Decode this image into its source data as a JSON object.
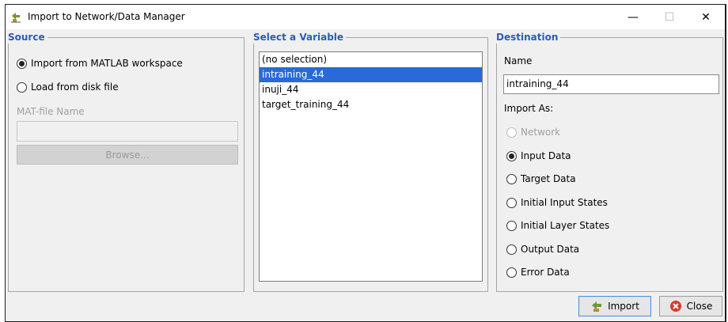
{
  "window": {
    "title": "Import to Network/Data Manager",
    "controls": {
      "minimize": "—",
      "maximize": "☐",
      "close": "✕"
    }
  },
  "source": {
    "title": "Source",
    "options": [
      {
        "label": "Import from MATLAB workspace",
        "checked": true
      },
      {
        "label": "Load from disk file",
        "checked": false
      }
    ],
    "mat_file_label": "MAT-file Name",
    "mat_file_value": "",
    "browse_label": "Browse..."
  },
  "variable": {
    "title": "Select a Variable",
    "items": [
      {
        "label": "(no selection)",
        "selected": false
      },
      {
        "label": "intraining_44",
        "selected": true
      },
      {
        "label": "inuji_44",
        "selected": false
      },
      {
        "label": "target_training_44",
        "selected": false
      }
    ]
  },
  "destination": {
    "title": "Destination",
    "name_label": "Name",
    "name_value": "intraining_44",
    "import_as_label": "Import As:",
    "options": [
      {
        "label": "Network",
        "checked": false,
        "disabled": true
      },
      {
        "label": "Input Data",
        "checked": true,
        "disabled": false
      },
      {
        "label": "Target Data",
        "checked": false,
        "disabled": false
      },
      {
        "label": "Initial Input States",
        "checked": false,
        "disabled": false
      },
      {
        "label": "Initial Layer States",
        "checked": false,
        "disabled": false
      },
      {
        "label": "Output Data",
        "checked": false,
        "disabled": false
      },
      {
        "label": "Error Data",
        "checked": false,
        "disabled": false
      }
    ]
  },
  "buttons": {
    "import_label": "Import",
    "close_label": "Close"
  },
  "colors": {
    "group_title": "#2a5db8",
    "selection": "#2a6ad8",
    "close_icon": "#d83a2a",
    "import_icon": "#5a8a2a"
  }
}
